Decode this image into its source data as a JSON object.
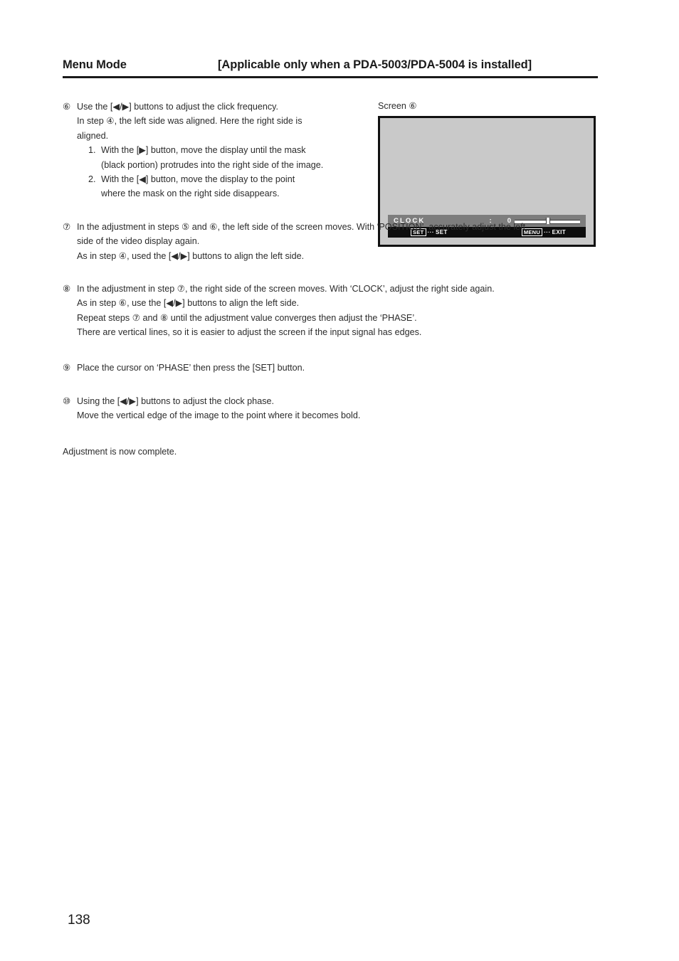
{
  "header": {
    "title": "Menu Mode",
    "subtitle": "[Applicable only when a PDA-5003/PDA-5004 is installed]"
  },
  "figure": {
    "caption": "Screen ⑥",
    "osd": {
      "label": "CLOCK",
      "colon": ":",
      "value": "0",
      "hint_left_key": "SET",
      "hint_left_dots": "···",
      "hint_left_action": "SET",
      "hint_right_key": "MENU",
      "hint_right_dots": "···",
      "hint_right_action": "EXIT"
    }
  },
  "steps": {
    "step6": {
      "marker": "⑥",
      "line1": "Use the [◀/▶] buttons to adjust the click frequency.",
      "line2": "In step ④, the left side was aligned. Here the right side is",
      "line3": "aligned.",
      "sub1_num": "1.",
      "sub1_line1": "With the [▶] button, move the display until the mask",
      "sub1_line2": "(black portion) protrudes into the right side of the image.",
      "sub2_num": "2.",
      "sub2_line1": "With the [◀] button, move the display to the point",
      "sub2_line2": "where the mask on the right side disappears."
    },
    "step7": {
      "marker": "⑦",
      "line1": "In the adjustment in steps ⑤ and ⑥, the left side of the screen moves. With ‘POSITION’, accurately adjust the left",
      "line2": "side of the video display again.",
      "line3": "As in step ④, used the [◀/▶] buttons to align the left side."
    },
    "step8": {
      "marker": "⑧",
      "line1": "In the adjustment in step ⑦, the right side of the screen moves. With ‘CLOCK’, adjust the right side again.",
      "line2": "As in step ⑥, use the [◀/▶] buttons to align the left side.",
      "line3": "Repeat steps ⑦ and ⑧ until the adjustment value converges then adjust the ‘PHASE’.",
      "line4": "There are vertical lines, so it is easier to adjust the screen if the input signal has edges."
    },
    "step9": {
      "marker": "⑨",
      "line1": "Place the cursor on ‘PHASE’ then press the [SET] button."
    },
    "step10": {
      "marker": "⑩",
      "line1": "Using the [◀/▶] buttons to adjust the clock phase.",
      "line2": "Move the vertical edge of the image to the point where it becomes bold."
    },
    "closing": "Adjustment is now complete."
  },
  "page_number": "138"
}
